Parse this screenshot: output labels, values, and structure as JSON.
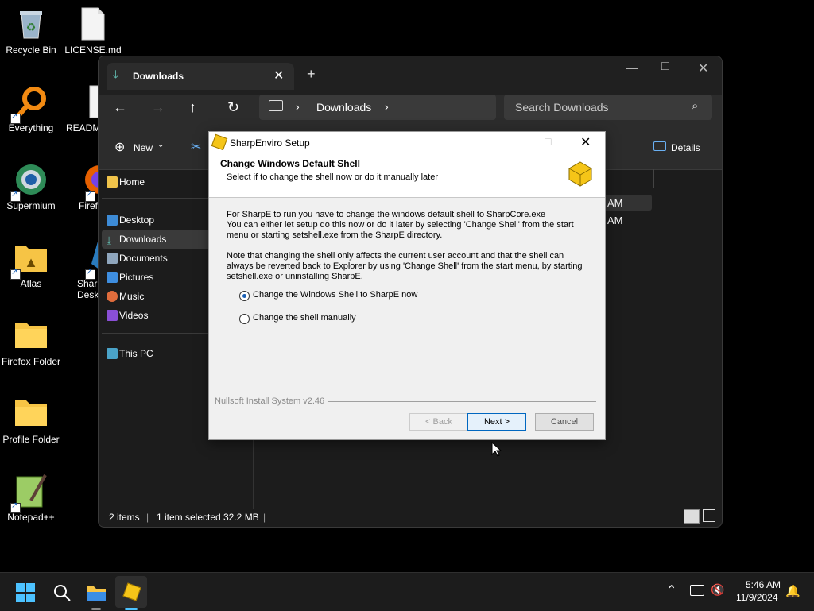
{
  "desktop": {
    "icons": [
      {
        "label": "Recycle Bin"
      },
      {
        "label": "LICENSE.md"
      },
      {
        "label": "Everything"
      },
      {
        "label": "READM"
      },
      {
        "label": "Supermium"
      },
      {
        "label": "Firef"
      },
      {
        "label": "Atlas"
      },
      {
        "label": "Sharp Deskt"
      },
      {
        "label": "Firefox Folder"
      },
      {
        "label": "Profile Folder"
      },
      {
        "label": "Notepad++"
      }
    ]
  },
  "explorer": {
    "tab_title": "Downloads",
    "breadcrumb": "Downloads",
    "search_placeholder": "Search Downloads",
    "new_label": "New",
    "details_label": "Details",
    "nav": [
      "Home",
      "Desktop",
      "Downloads",
      "Documents",
      "Pictures",
      "Music",
      "Videos",
      "This PC"
    ],
    "file_times": [
      "AM",
      "AM"
    ],
    "status": {
      "items": "2 items",
      "selected": "1 item selected",
      "size": "32.2 MB"
    }
  },
  "dialog": {
    "title": "SharpEnviro Setup",
    "header_title": "Change Windows Default Shell",
    "header_subtitle": "Select if to change the shell now or do it manually later",
    "para1": "For SharpE to run you have to change the windows default shell to SharpCore.exe\nYou can either let setup do this now or do it later by selecting 'Change Shell' from the start menu or starting setshell.exe from the SharpE directory.",
    "para2": "Note that changing the shell only affects the current user account and that the shell can always be reverted back to Explorer by using 'Change Shell' from the start menu, by starting setshell.exe or uninstalling SharpE.",
    "options": [
      {
        "label": "Change the Windows Shell to SharpE now",
        "selected": true
      },
      {
        "label": "Change the shell manually",
        "selected": false
      }
    ],
    "branding": "Nullsoft Install System v2.46",
    "back_label": "< Back",
    "next_label": "Next >",
    "cancel_label": "Cancel"
  },
  "taskbar": {
    "time": "5:46 AM",
    "date": "11/9/2024"
  },
  "colors": {
    "accent": "#0067c0",
    "folder": "#f6c445",
    "sharp_yellow": "#f5c518"
  }
}
